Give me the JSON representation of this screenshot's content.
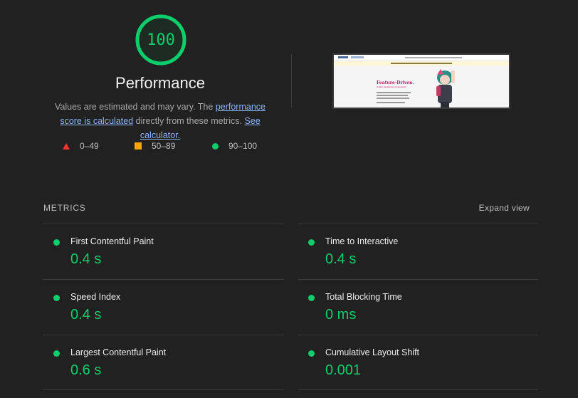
{
  "gauge": {
    "score": "100",
    "score_fraction": 1.0,
    "title": "Performance",
    "color": "#0cce6b"
  },
  "description": {
    "prefix": "Values are estimated and may vary. The ",
    "link1": "performance score is calculated",
    "middle": " directly from these metrics. ",
    "link2": "See calculator."
  },
  "legend": [
    {
      "range": "0–49",
      "shape": "triangle",
      "color": "#ff3333"
    },
    {
      "range": "50–89",
      "shape": "square",
      "color": "#ffa400"
    },
    {
      "range": "90–100",
      "shape": "circle",
      "color": "#0cce6b"
    }
  ],
  "screenshot": {
    "heading": "Feature-Driven.",
    "subheading": "Unified JavaScript components"
  },
  "metrics": {
    "title": "METRICS",
    "expand_label": "Expand view",
    "items": [
      {
        "label": "First Contentful Paint",
        "value": "0.4 s"
      },
      {
        "label": "Time to Interactive",
        "value": "0.4 s"
      },
      {
        "label": "Speed Index",
        "value": "0.4 s"
      },
      {
        "label": "Total Blocking Time",
        "value": "0 ms"
      },
      {
        "label": "Largest Contentful Paint",
        "value": "0.6 s"
      },
      {
        "label": "Cumulative Layout Shift",
        "value": "0.001"
      }
    ]
  }
}
